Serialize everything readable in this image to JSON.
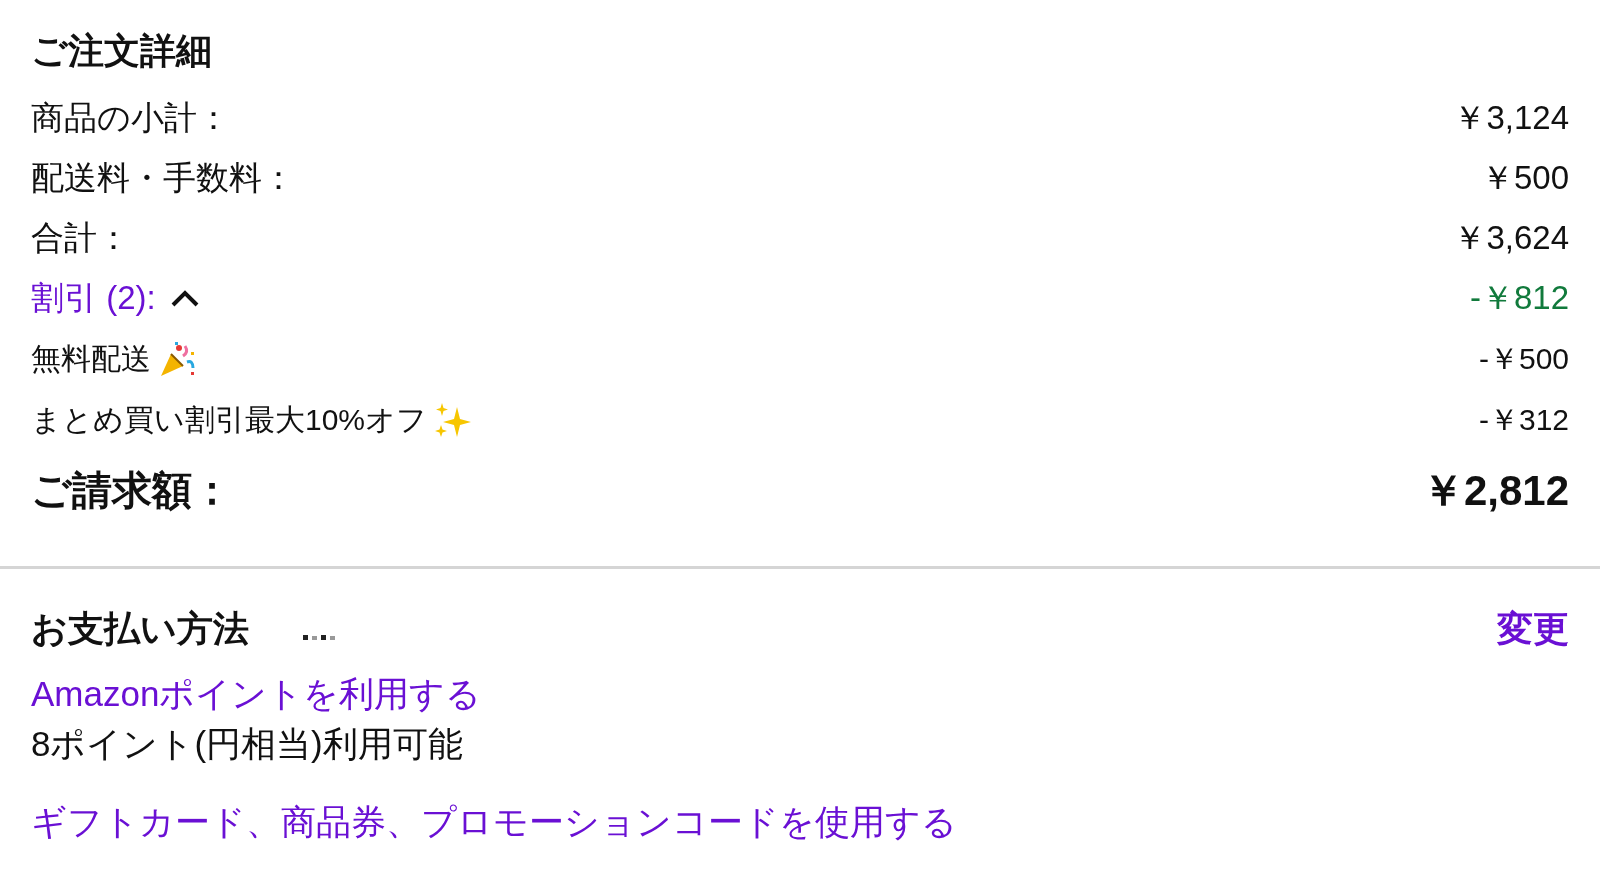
{
  "order_details": {
    "title": "ご注文詳細",
    "rows": [
      {
        "kind": "line",
        "label": "商品の小計：",
        "amount": "￥3,124"
      },
      {
        "kind": "line",
        "label": "配送料・手数料：",
        "amount": "￥500"
      },
      {
        "kind": "line",
        "label": "合計：",
        "amount": "￥3,624"
      },
      {
        "kind": "discount",
        "label": "割引 (2):",
        "expanded": true,
        "amount": "-￥812"
      },
      {
        "kind": "party_item",
        "label": "無料配送",
        "amount": "-￥500"
      },
      {
        "kind": "sparkles_item",
        "label": "まとめ買い割引最大10%オフ",
        "amount": "-￥312"
      }
    ],
    "total": {
      "label": "ご請求額：",
      "amount": "￥2,812"
    }
  },
  "payment": {
    "title": "お支払い方法",
    "loading": true,
    "change_link": "変更",
    "points_link": "Amazonポイントを利用する",
    "points_available": "8ポイント(円相当)利用可能",
    "gift_link": "ギフトカード、商品券、プロモーションコードを使用する"
  }
}
